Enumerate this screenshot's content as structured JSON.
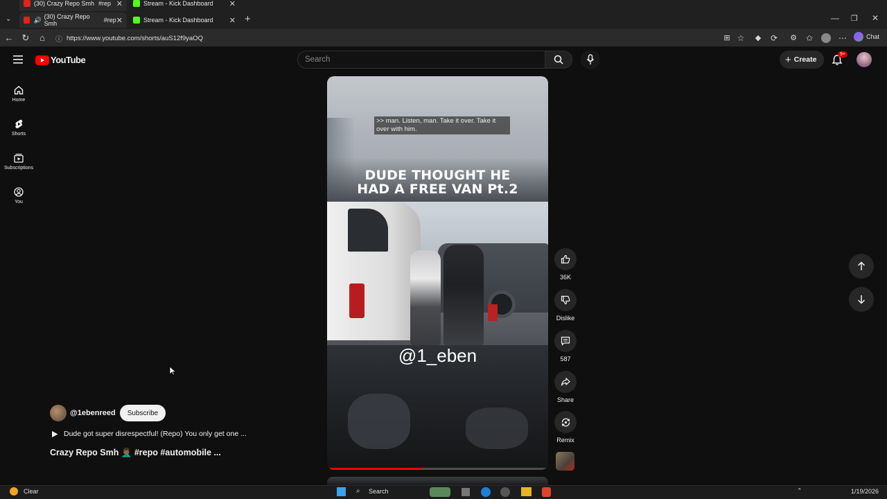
{
  "browser": {
    "tabs": [
      {
        "title": "(30) Crazy Repo Smh",
        "suffix": "#rep",
        "active": true
      },
      {
        "title": "Stream - Kick Dashboard",
        "active": false
      }
    ],
    "ghost_tabs": [
      {
        "title": "(30) Crazy Repo Smh",
        "suffix": "#rep"
      },
      {
        "title": "Stream - Kick Dashboard"
      }
    ],
    "url": "https://www.youtube.com/shorts/auS12f9yaOQ",
    "chat_label": "Chat",
    "new_tab": "+"
  },
  "header": {
    "logo_text": "YouTube",
    "search_placeholder": "Search",
    "create_label": "Create",
    "notif_badge": "9+"
  },
  "sidebar": {
    "items": [
      {
        "label": "Home",
        "icon": "home-icon"
      },
      {
        "label": "Shorts",
        "icon": "shorts-icon"
      },
      {
        "label": "Subscriptions",
        "icon": "subscriptions-icon"
      },
      {
        "label": "You",
        "icon": "you-icon"
      }
    ]
  },
  "video": {
    "caption": ">> man. Listen, man. Take it over. Take it over with him.",
    "overlay_line1": "DUDE THOUGHT HE",
    "overlay_line2": "HAD A FREE VAN Pt.2",
    "handle_overlay": "@1_eben",
    "progress": 0.43
  },
  "actions": {
    "like_count": "36K",
    "dislike_label": "Dislike",
    "comment_count": "587",
    "share_label": "Share",
    "remix_label": "Remix"
  },
  "meta": {
    "channel": "@1ebenreed",
    "subscribe_label": "Subscribe",
    "description": "Dude got super disrespectful! (Repo) You only get one ...",
    "title": "Crazy Repo Smh 🤦🏾‍♂️ #repo #automobile ..."
  },
  "taskbar": {
    "weather": "Clear",
    "search": "Search",
    "date": "1/19/2026"
  },
  "colors": {
    "accent": "#ff0000",
    "bg": "#0f0f0f"
  }
}
